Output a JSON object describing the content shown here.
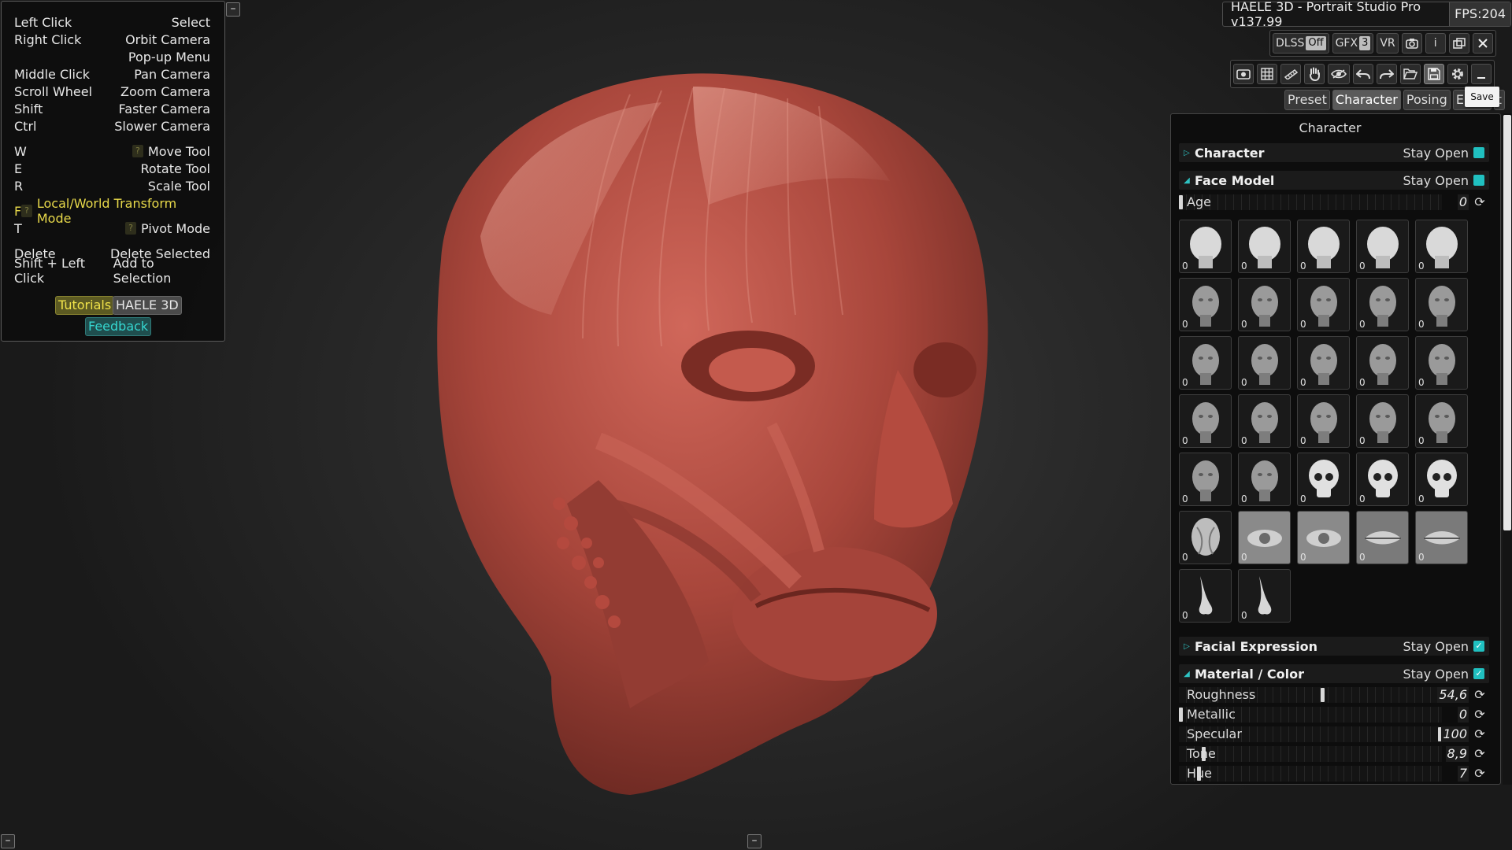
{
  "help": {
    "rows": [
      {
        "key": "Left Click",
        "value": "Select"
      },
      {
        "key": "Right Click",
        "value": "Orbit Camera"
      },
      {
        "key": "",
        "value": "Pop-up Menu"
      },
      {
        "key": "Middle Click",
        "value": "Pan Camera"
      },
      {
        "key": "Scroll Wheel",
        "value": "Zoom Camera"
      },
      {
        "key": "Shift",
        "value": "Faster Camera"
      },
      {
        "key": "Ctrl",
        "value": "Slower Camera"
      },
      {
        "key": "W",
        "value": "Move Tool"
      },
      {
        "key": "E",
        "value": "Rotate Tool"
      },
      {
        "key": "R",
        "value": "Scale Tool"
      },
      {
        "key": "F",
        "value": "Local/World Transform Mode"
      },
      {
        "key": "T",
        "value": "Pivot Mode"
      },
      {
        "key": "Delete",
        "value": "Delete Selected"
      },
      {
        "key": "Shift + Left Click",
        "value": "Add to Selection"
      }
    ],
    "qmark": "?",
    "buttons": {
      "tutorials": "Tutorials",
      "haele": "HAELE 3D",
      "feedback": "Feedback"
    },
    "collapse": "–"
  },
  "title": {
    "app": "HAELE 3D - Portrait Studio Pro v137.99",
    "fps": "FPS:204"
  },
  "toolbar1": {
    "dlss_label": "DLSS",
    "dlss_value": "Off",
    "gfx_label": "GFX",
    "gfx_value": "3",
    "vr": "VR",
    "info": "i"
  },
  "toolbar2": {
    "icons": [
      "screenshot-icon",
      "grid-icon",
      "ruler-icon",
      "hand-icon",
      "eye-icon",
      "undo-icon",
      "redo-icon",
      "folder-open-icon",
      "save-icon",
      "gear-icon",
      "minimize-icon"
    ]
  },
  "tooltip": "Save",
  "tabs": [
    "Preset",
    "Character",
    "Posing",
    "Envir",
    "t"
  ],
  "panel": {
    "title": "Character",
    "sections": {
      "character": "Character",
      "face_model": "Face Model",
      "facial_expression": "Facial Expression",
      "material": "Material / Color"
    },
    "stay_open": "Stay Open",
    "age": {
      "label": "Age",
      "value": "0",
      "level": 0
    },
    "thumbnails": [
      {
        "kind": "mannequin",
        "count": "0"
      },
      {
        "kind": "mannequin",
        "count": "0"
      },
      {
        "kind": "mannequin",
        "count": "0"
      },
      {
        "kind": "mannequin",
        "count": "0"
      },
      {
        "kind": "mannequin",
        "count": "0"
      },
      {
        "kind": "head",
        "count": "0"
      },
      {
        "kind": "head",
        "count": "0"
      },
      {
        "kind": "head",
        "count": "0"
      },
      {
        "kind": "head",
        "count": "0"
      },
      {
        "kind": "head",
        "count": "0"
      },
      {
        "kind": "head",
        "count": "0"
      },
      {
        "kind": "head",
        "count": "0"
      },
      {
        "kind": "head",
        "count": "0"
      },
      {
        "kind": "head",
        "count": "0"
      },
      {
        "kind": "head",
        "count": "0"
      },
      {
        "kind": "head",
        "count": "0"
      },
      {
        "kind": "head",
        "count": "0"
      },
      {
        "kind": "head",
        "count": "0"
      },
      {
        "kind": "head",
        "count": "0"
      },
      {
        "kind": "head",
        "count": "0"
      },
      {
        "kind": "head",
        "count": "0"
      },
      {
        "kind": "head",
        "count": "0"
      },
      {
        "kind": "skull",
        "count": "0"
      },
      {
        "kind": "skull",
        "count": "0"
      },
      {
        "kind": "skull",
        "count": "0"
      },
      {
        "kind": "ecorche",
        "count": "0"
      },
      {
        "kind": "eye",
        "count": "0"
      },
      {
        "kind": "eye",
        "count": "0"
      },
      {
        "kind": "lips",
        "count": "0"
      },
      {
        "kind": "lips",
        "count": "0"
      },
      {
        "kind": "nose",
        "count": "0"
      },
      {
        "kind": "nose",
        "count": "0"
      }
    ],
    "material": [
      {
        "label": "Roughness",
        "value": "54,6",
        "level": 0.546
      },
      {
        "label": "Metallic",
        "value": "0",
        "level": 0
      },
      {
        "label": "Specular",
        "value": "100",
        "level": 1.0
      },
      {
        "label": "Tone",
        "value": "8,9",
        "level": 0.089
      },
      {
        "label": "Hue",
        "value": "7",
        "level": 0.07
      }
    ]
  },
  "colors": {
    "accent": "#20c0c0",
    "model": "#b5473c",
    "highlight_yellow": "#e8d94a"
  }
}
